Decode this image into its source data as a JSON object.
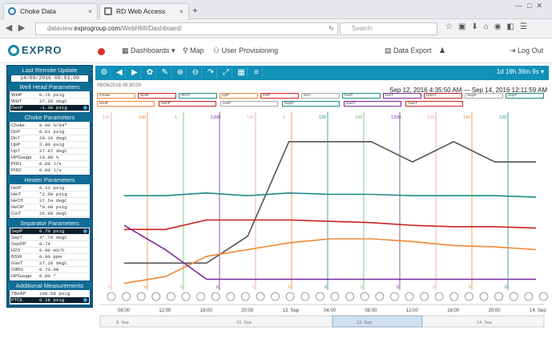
{
  "browser": {
    "tabs": [
      {
        "label": "Choke Data",
        "close": "×"
      },
      {
        "label": "RD Web Access",
        "close": "×"
      }
    ],
    "new_tab": "+",
    "url_prefix": "dataview.",
    "url_domain": "exprogroup.com",
    "url_path": "/WebHMI/Dashboard/",
    "search_placeholder": "Search"
  },
  "app": {
    "logo": "EXPRO",
    "menu": {
      "dashboards": "Dashboards ▾",
      "map": "Map",
      "user_provisioning": "User Provisioning"
    },
    "actions": {
      "data_export": "Data Export",
      "logout": "Log Out"
    }
  },
  "sidebar": {
    "last_update_title": "Last Remote Update",
    "last_update_value": "14/09/2016 08:03:00",
    "sections": [
      {
        "title": "Well Head Parameters",
        "rows": [
          {
            "k": "WHP",
            "v": "0.76 psig"
          },
          {
            "k": "WHT",
            "v": "27.26 degC"
          },
          {
            "k": "DenP",
            "v": "-1.38 psig",
            "hl": true
          }
        ]
      },
      {
        "title": "Choke Parameters",
        "rows": [
          {
            "k": "Choke",
            "v": "0.00 %/64\""
          },
          {
            "k": "DnP",
            "v": "0.01 psig"
          },
          {
            "k": "DnT",
            "v": "28.16 degC"
          },
          {
            "k": "UpP",
            "v": "2.00 psig"
          },
          {
            "k": "UpT",
            "v": "27.97 degC"
          },
          {
            "k": "HPGauge",
            "v": "10.00 %"
          },
          {
            "k": "PIR1",
            "v": "0.00 l/s"
          },
          {
            "k": "PIR2",
            "v": "0.00 l/s"
          }
        ]
      },
      {
        "title": "Heater Parameters",
        "rows": [
          {
            "k": "HeiP",
            "v": "0.12 psig"
          },
          {
            "k": "HeiT",
            "v": "*2.00 psig"
          },
          {
            "k": "HeOT",
            "v": "27.54 degC"
          },
          {
            "k": "HeOP",
            "v": "*0.00 psig"
          },
          {
            "k": "CoiT",
            "v": "26.00 degC"
          }
        ]
      },
      {
        "title": "Separator Parameters",
        "rows": [
          {
            "k": "SepP",
            "v": "0.70 psig",
            "hl": true
          },
          {
            "k": "SepT",
            "v": "4*.76 degC"
          },
          {
            "k": "SepDP",
            "v": "0.74"
          },
          {
            "k": "H2S",
            "v": "0.00 m3/h"
          },
          {
            "k": "BSW",
            "v": "0.00 ppm"
          },
          {
            "k": "GasT",
            "v": "27.16 degC"
          },
          {
            "k": "OilBS",
            "v": "0.70.00"
          },
          {
            "k": "HPGauge",
            "v": "0.00 *"
          }
        ]
      },
      {
        "title": "Additional Measurements",
        "rows": [
          {
            "k": "TBeAP",
            "v": "108.58 psig"
          },
          {
            "k": "PTOL",
            "v": "0.18 psig",
            "hl": true
          }
        ]
      }
    ]
  },
  "toolbar": {
    "buttons": [
      "gear-icon",
      "arrow-left-icon",
      "arrow-right-icon",
      "gear-small-icon",
      "wrench-icon",
      "zoom-in-icon",
      "zoom-out-icon",
      "redo-icon",
      "expand-icon",
      "table-icon",
      "menu-icon"
    ],
    "range_label": "1d 19h 36m 9s ▾"
  },
  "chart": {
    "date_label": "09/06/2016 09:30:00",
    "title": "Sep 12, 2016 4:35:50 AM — Sep 14, 2016 12:11:59 AM",
    "chips_row1": [
      "Choke",
      "WHP",
      "WHT",
      "UpP",
      "DnP",
      "DnT",
      "HeiP",
      "HeiT",
      "HeOT",
      "SepP",
      "SepT"
    ],
    "chips_row2": [
      "WHP",
      "DenP",
      "HeiP",
      "SepP",
      "GasT",
      "GasT"
    ],
    "x_ticks": [
      "08:00",
      "12:00",
      "16:00",
      "20:00",
      "13. Sep",
      "04:00",
      "08:00",
      "12:00",
      "16:00",
      "20:00",
      "14. Sep"
    ],
    "nav_ticks": [
      "8. Sep",
      "10. Sep",
      "12. Sep",
      "14. Sep"
    ],
    "y_labels_top": [
      "120",
      "14K",
      "1",
      "1200",
      "120",
      "1",
      "120",
      "14K",
      "1200",
      "120",
      "14K",
      "120"
    ],
    "y_labels_bot": [
      "0",
      "0",
      "0",
      "0",
      "0",
      "0",
      "0",
      "0",
      "0",
      "0",
      "0",
      "0"
    ]
  },
  "chart_data": {
    "type": "line",
    "title": "Sep 12, 2016 4:35:50 AM — Sep 14, 2016 12:11:59 AM",
    "x": [
      "08:00",
      "12:00",
      "16:00",
      "20:00",
      "13. Sep",
      "04:00",
      "08:00",
      "12:00",
      "16:00",
      "20:00",
      "14. Sep"
    ],
    "series": [
      {
        "name": "WHP",
        "color": "#555555",
        "values": [
          20,
          20,
          20,
          40,
          110,
          110,
          110,
          95,
          110,
          95,
          95
        ]
      },
      {
        "name": "SepP",
        "color": "#1a8a8a",
        "values": [
          70,
          70,
          72,
          70,
          72,
          71,
          71,
          70,
          70,
          70,
          69
        ]
      },
      {
        "name": "DnT",
        "color": "#cc2222",
        "values": [
          45,
          45,
          52,
          52,
          52,
          51,
          50,
          48,
          47,
          47,
          46
        ]
      },
      {
        "name": "UpT",
        "color": "#ee8833",
        "values": [
          5,
          10,
          25,
          30,
          35,
          38,
          38,
          36,
          33,
          32,
          30
        ]
      },
      {
        "name": "Choke",
        "color": "#7a2a9a",
        "values": [
          48,
          30,
          8,
          8,
          8,
          8,
          8,
          8,
          8,
          8,
          8
        ]
      }
    ],
    "ylim": [
      0,
      120
    ]
  },
  "colors": {
    "brand": "#1190b8",
    "sidebar": "#0f5c80"
  }
}
